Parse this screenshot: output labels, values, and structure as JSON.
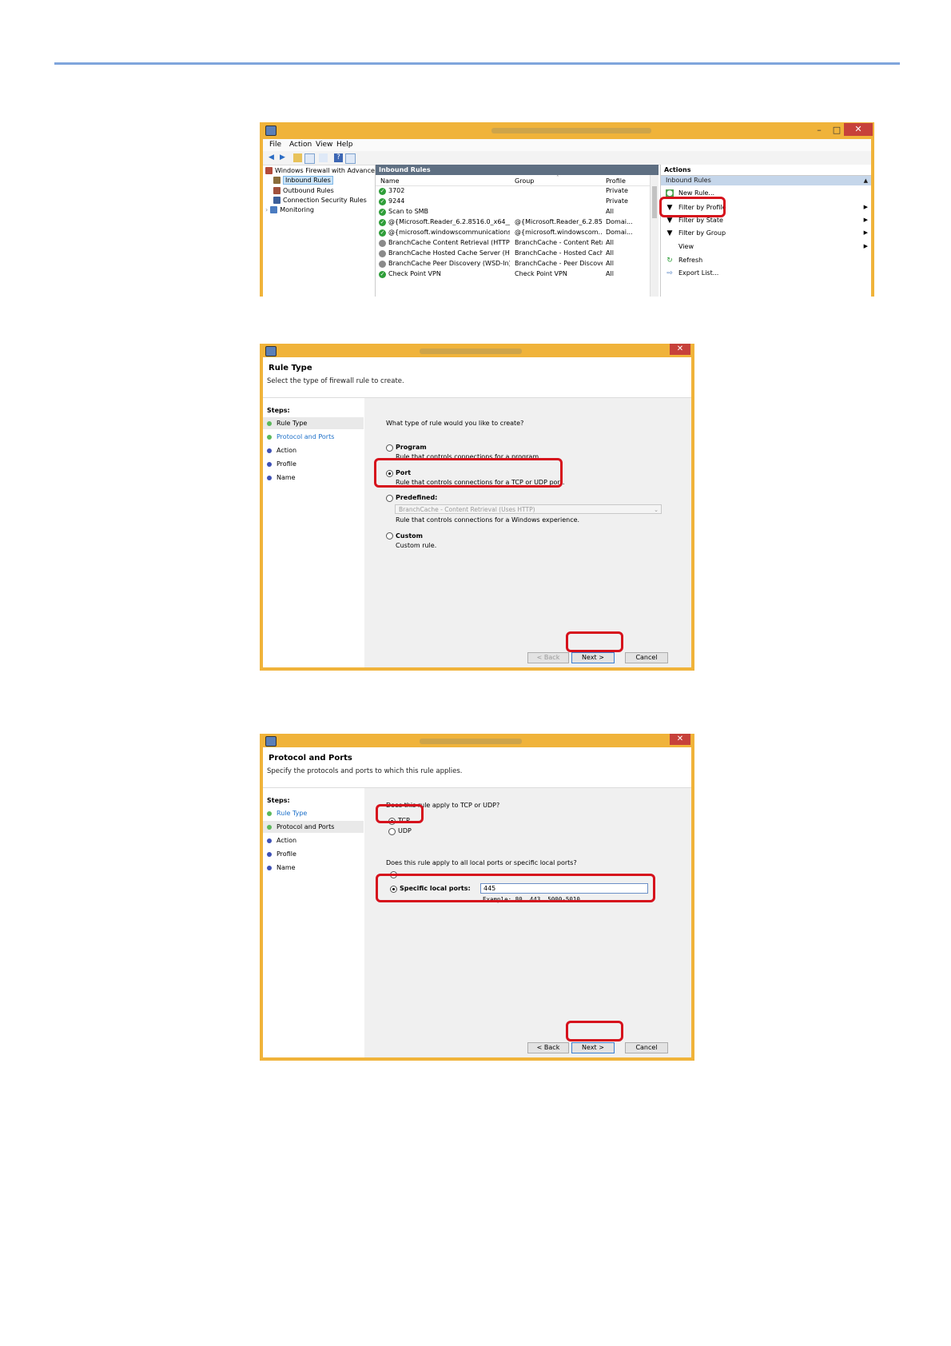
{
  "window1": {
    "menu": [
      "File",
      "Action",
      "View",
      "Help"
    ],
    "tree": {
      "root": "Windows Firewall with Advance",
      "items": [
        "Inbound Rules",
        "Outbound Rules",
        "Connection Security Rules",
        "Monitoring"
      ]
    },
    "pane_title": "Inbound Rules",
    "columns": [
      "Name",
      "Group",
      "Profile"
    ],
    "rows": [
      {
        "name": "3702",
        "group": "",
        "profile": "Private"
      },
      {
        "name": "9244",
        "group": "",
        "profile": "Private"
      },
      {
        "name": "Scan to SMB",
        "group": "",
        "profile": "All"
      },
      {
        "name": "@{Microsoft.Reader_6.2.8516.0_x64__8we...",
        "group": "@{Microsoft.Reader_6.2.851...",
        "profile": "Domai..."
      },
      {
        "name": "@{microsoft.windowscommunicationsa...",
        "group": "@{microsoft.windowscom...",
        "profile": "Domai..."
      },
      {
        "name": "BranchCache Content Retrieval (HTTP-In)",
        "group": "BranchCache - Content Retr...",
        "profile": "All"
      },
      {
        "name": "BranchCache Hosted Cache Server (HTT...",
        "group": "BranchCache - Hosted Cach...",
        "profile": "All"
      },
      {
        "name": "BranchCache Peer Discovery (WSD-In)",
        "group": "BranchCache - Peer Discove...",
        "profile": "All"
      },
      {
        "name": "Check Point VPN",
        "group": "Check Point VPN",
        "profile": "All"
      }
    ],
    "actions": {
      "title": "Actions",
      "section": "Inbound Rules",
      "items": [
        "New Rule...",
        "Filter by Profile",
        "Filter by State",
        "Filter by Group",
        "View",
        "Refresh",
        "Export List..."
      ]
    }
  },
  "dialog1": {
    "title": "Rule Type",
    "description": "Select the type of firewall rule to create.",
    "steps_title": "Steps:",
    "steps": [
      "Rule Type",
      "Protocol and Ports",
      "Action",
      "Profile",
      "Name"
    ],
    "question": "What type of rule would you like to create?",
    "options": [
      {
        "title": "Program",
        "desc": "Rule that controls connections for a program."
      },
      {
        "title": "Port",
        "desc": "Rule that controls connections for a TCP or UDP port."
      },
      {
        "title": "Predefined:",
        "desc": "Rule that controls connections for a Windows experience."
      },
      {
        "title": "Custom",
        "desc": "Custom rule."
      }
    ],
    "predefined_value": "BranchCache - Content Retrieval (Uses HTTP)",
    "selected": "Port",
    "buttons": {
      "back": "< Back",
      "next": "Next >",
      "cancel": "Cancel"
    }
  },
  "dialog2": {
    "title": "Protocol and Ports",
    "description": "Specify the protocols and ports to which this rule applies.",
    "steps_title": "Steps:",
    "steps": [
      "Rule Type",
      "Protocol and Ports",
      "Action",
      "Profile",
      "Name"
    ],
    "question1": "Does this rule apply to TCP or UDP?",
    "tcp": "TCP",
    "udp": "UDP",
    "question2": "Does this rule apply to all local ports or specific local ports?",
    "specific_label": "Specific local ports:",
    "ports_value": "445",
    "example": "Example: 80, 443, 5000-5010",
    "buttons": {
      "back": "< Back",
      "next": "Next >",
      "cancel": "Cancel"
    }
  },
  "colors": {
    "accent_rule": "#7fa5dc",
    "window_frame": "#f0b33a",
    "highlight": "#d6111c"
  }
}
